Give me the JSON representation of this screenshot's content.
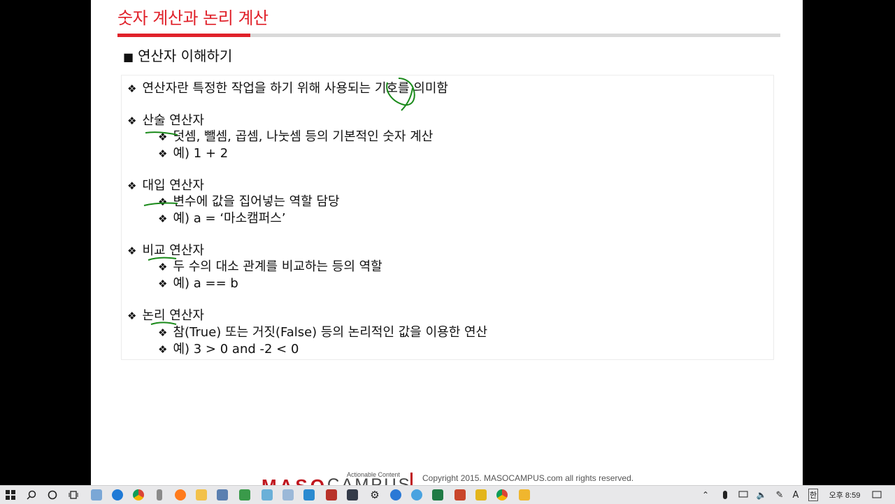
{
  "slide": {
    "title": "숫자 계산과 논리 계산",
    "subtitle_bullet": "■",
    "subtitle": "연산자 이해하기",
    "bullet_glyph": "❖",
    "definition": "연산자란 특정한 작업을 하기 위해 사용되는 기호를 의미함",
    "sections": [
      {
        "heading": "산술 연산자",
        "desc": "덧셈, 뺄셈, 곱셈, 나눗셈 등의 기본적인 숫자 계산",
        "example": "예) 1 + 2"
      },
      {
        "heading": "대입 연산자",
        "desc": "변수에 값을 집어넣는 역할 담당",
        "example": "예) a = ‘마소캠퍼스’"
      },
      {
        "heading": "비교 연산자",
        "desc": "두 수의 대소 관계를 비교하는 등의 역할",
        "example": "예) a == b"
      },
      {
        "heading": "논리 연산자",
        "desc": "참(True) 또는 거짓(False) 등의 논리적인 값을 이용한 연산",
        "example": "예) 3 > 0 and -2 < 0"
      }
    ],
    "footer": {
      "brand_part1": "MASO",
      "brand_part2": "CAMPUS",
      "tagline": "Actionable Content",
      "copyright": "Copyright 2015. MASOCAMPUS.com all rights reserved."
    }
  },
  "taskbar": {
    "start_icon": "windows-logo-icon",
    "ime_label": "A",
    "ime_hangul": "한",
    "clock": "오후 8:59",
    "apps": [
      "search-icon",
      "cortana-icon",
      "task-view-icon",
      "app-icon",
      "edge-icon",
      "chrome-icon",
      "app-icon",
      "firefox-icon",
      "folder-icon",
      "app-icon",
      "app-icon",
      "app-icon",
      "app-icon",
      "app-icon",
      "app-64-icon",
      "app-icon",
      "gear-icon",
      "app-icon",
      "app-icon",
      "excel-icon",
      "powerpoint-icon",
      "app-icon",
      "chrome-icon",
      "app-icon"
    ]
  },
  "colors": {
    "accent": "#e0212a",
    "ink": "#1a8a1a",
    "taskbar": "#e8e8ea"
  }
}
